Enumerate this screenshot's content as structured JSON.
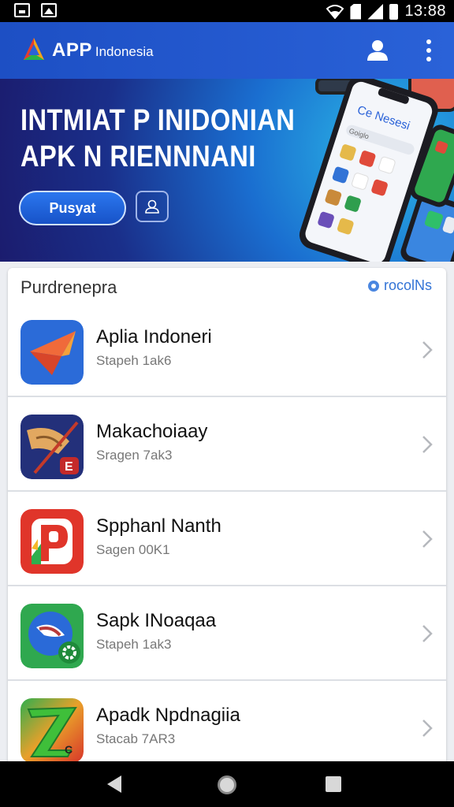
{
  "status_bar": {
    "time": "13:88",
    "icons": [
      "notification-icon",
      "image-icon",
      "wifi-icon",
      "sim-icon",
      "signal-icon",
      "battery-icon"
    ]
  },
  "app_bar": {
    "brand_main": "APP",
    "brand_sub": "Indonesia",
    "icons": [
      "app-logo",
      "user-icon",
      "more-vert-icon"
    ],
    "color": "#1f55c9"
  },
  "hero": {
    "title_line1": "INTMIAT P INIDONIAN",
    "title_line2": "APK N RIENNNANI",
    "button_label": "Pusyat",
    "screen_label": "Ce Nesesi",
    "search_label": "Goiglo"
  },
  "list": {
    "header": "Purdrenepra",
    "action_label": "rocolNs",
    "items": [
      {
        "name": "Aplia Indoneri",
        "sub": "Stapeh 1ak6",
        "icon": "arrow-app-icon"
      },
      {
        "name": "Makachoiaay",
        "sub": "Sragen 7ak3",
        "icon": "bird-app-icon"
      },
      {
        "name": "Spphanl Nanth",
        "sub": "Sagen 00K1",
        "icon": "p-app-icon"
      },
      {
        "name": "Sapk INoaqaa",
        "sub": "Stapeh 1ak3",
        "icon": "settings-app-icon"
      },
      {
        "name": "Apadk Npdnagiia",
        "sub": "Stacab 7AR3",
        "icon": "z-app-icon"
      }
    ]
  },
  "nav_bar": {
    "icons": [
      "back-icon",
      "home-icon",
      "recents-icon"
    ]
  }
}
